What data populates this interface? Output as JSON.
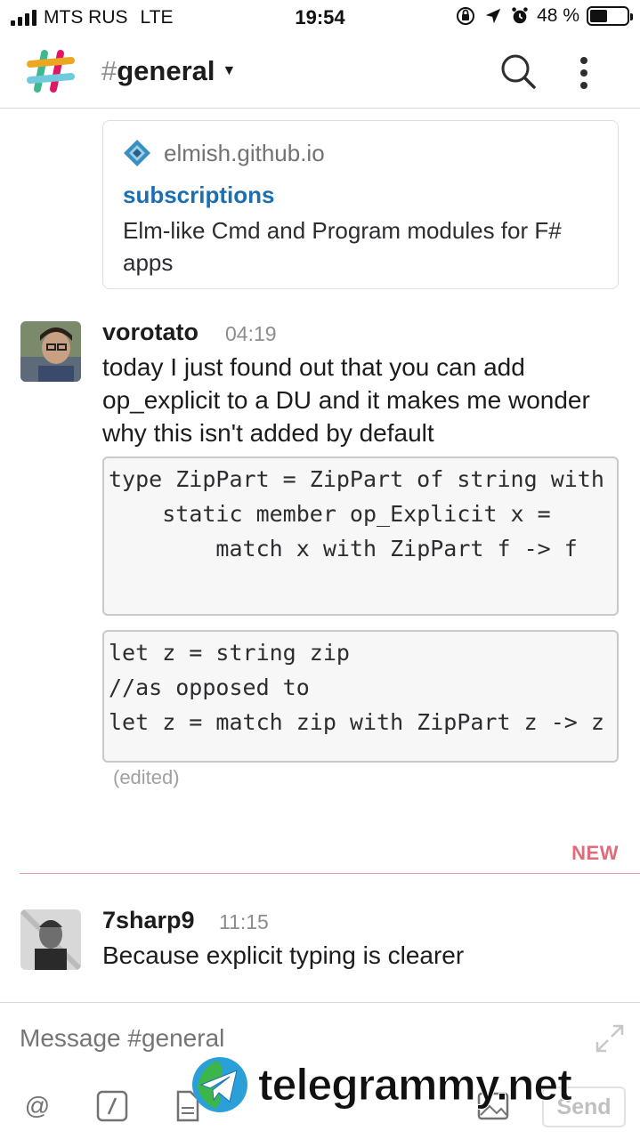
{
  "status_bar": {
    "carrier": "MTS RUS",
    "network": "LTE",
    "time": "19:54",
    "battery_percent": "48 %",
    "battery_level": 0.48
  },
  "header": {
    "hash": "#",
    "channel_name": "general"
  },
  "attachment": {
    "site": "elmish.github.io",
    "title": "subscriptions",
    "description": "Elm-like Cmd and Program modules for F# apps"
  },
  "messages": [
    {
      "author": "vorotato",
      "time": "04:19",
      "text": "today I just found out that you can add op_explicit to a DU and it makes me wonder why this isn't added by default",
      "code_blocks": [
        [
          "type ZipPart = ZipPart of string with",
          "    static member op_Explicit x =",
          "        match x with ZipPart f -> f"
        ],
        [
          "let z = string zip",
          "//as opposed to",
          "let z = match zip with ZipPart z -> z"
        ]
      ],
      "edited_label": "(edited)"
    },
    {
      "author": "7sharp9",
      "time": "11:15",
      "text": "Because explicit typing is clearer"
    }
  ],
  "new_divider_label": "NEW",
  "composer": {
    "placeholder": "Message #general",
    "send_label": "Send"
  },
  "watermark": "telegrammy.net",
  "colors": {
    "link": "#1b6fb1",
    "new_divider": "#e06b7b"
  }
}
